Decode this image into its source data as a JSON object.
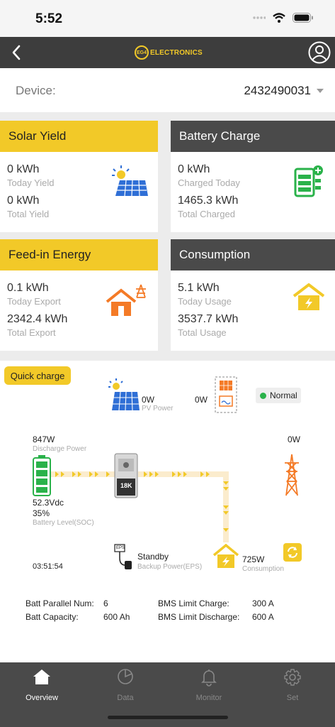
{
  "status": {
    "time": "5:52"
  },
  "header": {
    "logo_mark": "EG4",
    "logo_text": "ELECTRONICS"
  },
  "device": {
    "label": "Device:",
    "value": "2432490031"
  },
  "cards": {
    "solar": {
      "title": "Solar Yield",
      "v1": "0 kWh",
      "l1": "Today Yield",
      "v2": "0 kWh",
      "l2": "Total Yield"
    },
    "battery": {
      "title": "Battery Charge",
      "v1": "0 kWh",
      "l1": "Charged Today",
      "v2": "1465.3 kWh",
      "l2": "Total Charged"
    },
    "feedin": {
      "title": "Feed-in Energy",
      "v1": "0.1 kWh",
      "l1": "Today Export",
      "v2": "2342.4 kWh",
      "l2": "Total Export"
    },
    "consumption": {
      "title": "Consumption",
      "v1": "5.1 kWh",
      "l1": "Today Usage",
      "v2": "3537.7 kWh",
      "l2": "Total Usage"
    }
  },
  "flow": {
    "quick_charge": "Quick charge",
    "pv_power": "0W",
    "pv_label": "PV Power",
    "inverter_power": "0W",
    "status": "Normal",
    "discharge_power": "847W",
    "discharge_label": "Discharge Power",
    "grid_power": "0W",
    "battery_voltage": "52.3Vdc",
    "battery_soc": "35%",
    "battery_label": "Battery Level(SOC)",
    "inverter_badge": "18K",
    "eps_status": "Standby",
    "eps_label": "Backup Power(EPS)",
    "consumption_power": "725W",
    "consumption_label": "Consumption",
    "time": "03:51:54",
    "eps_tag": "EPS"
  },
  "info": {
    "batt_parallel_label": "Batt Parallel Num:",
    "batt_parallel_value": "6",
    "batt_capacity_label": "Batt Capacity:",
    "batt_capacity_value": "600 Ah",
    "bms_charge_label": "BMS Limit Charge:",
    "bms_charge_value": "300 A",
    "bms_discharge_label": "BMS Limit Discharge:",
    "bms_discharge_value": "600 A"
  },
  "tabs": [
    {
      "label": "Overview",
      "icon": "home-icon"
    },
    {
      "label": "Data",
      "icon": "pie-chart-icon"
    },
    {
      "label": "Monitor",
      "icon": "bell-icon"
    },
    {
      "label": "Set",
      "icon": "gear-icon"
    }
  ],
  "colors": {
    "accent": "#f2c928",
    "dark": "#4a4a4a",
    "orange": "#f47a26",
    "green": "#2ab24a",
    "blue": "#2f6fd6"
  }
}
